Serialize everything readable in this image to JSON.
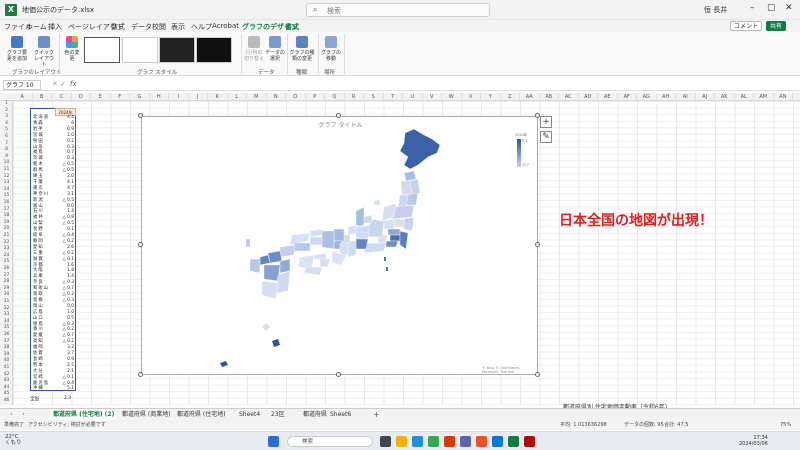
{
  "titlebar": {
    "filename": "地価公示のデータ.xlsx",
    "search_placeholder": "検索",
    "user": "恒 長井",
    "icon": "excel-icon"
  },
  "menu": {
    "items": [
      "ファイル",
      "ホーム",
      "挿入",
      "ページレイアウト",
      "数式",
      "データ",
      "校閲",
      "表示",
      "ヘルプ",
      "Acrobat",
      "グラフのデザイン",
      "書式"
    ],
    "active": "グラフのデザイン",
    "comment_btn": "コメント",
    "share_btn": "共有"
  },
  "ribbon": {
    "buttons": [
      {
        "label": "グラフ要素を追加",
        "icon": "add-chart-element-icon"
      },
      {
        "label": "クイックレイアウト",
        "icon": "quick-layout-icon"
      },
      {
        "label": "色の変更",
        "icon": "palette-icon"
      },
      {
        "label": "行/列の切り替え",
        "icon": "switch-row-col-icon"
      },
      {
        "label": "データの選択",
        "icon": "select-data-icon"
      },
      {
        "label": "グラフの種類の変更",
        "icon": "chart-type-icon"
      },
      {
        "label": "グラフの移動",
        "icon": "move-chart-icon"
      }
    ],
    "groups": [
      "グラフのレイアウト",
      "グラフ スタイル",
      "データ",
      "種類",
      "場所"
    ]
  },
  "formula_bar": {
    "namebox": "グラフ 10",
    "fx": "fx"
  },
  "columns": [
    "A",
    "B",
    "C",
    "D",
    "E",
    "F",
    "G",
    "H",
    "I",
    "J",
    "K",
    "L",
    "M",
    "N",
    "O",
    "P",
    "Q",
    "R",
    "S",
    "T",
    "U",
    "V",
    "W",
    "X",
    "Y",
    "Z",
    "AA",
    "AB",
    "AC",
    "AD",
    "AE",
    "AF",
    "AG",
    "AH",
    "AI",
    "AJ",
    "AK",
    "AL",
    "AM",
    "AN"
  ],
  "rows_count": 46,
  "table": {
    "header": "2024年",
    "rows": [
      {
        "pref": "北海道",
        "val": "4.4"
      },
      {
        "pref": "青森",
        "val": "6"
      },
      {
        "pref": "岩手",
        "val": "0.9"
      },
      {
        "pref": "宮城",
        "val": "1.0"
      },
      {
        "pref": "秋田",
        "val": "0.2"
      },
      {
        "pref": "山形",
        "val": "0.3"
      },
      {
        "pref": "福島",
        "val": "0.7"
      },
      {
        "pref": "茨城",
        "val": "0.3"
      },
      {
        "pref": "栃木",
        "val": "△ 0.5"
      },
      {
        "pref": "群馬",
        "val": "△ 0.5"
      },
      {
        "pref": "埼玉",
        "val": "2.0"
      },
      {
        "pref": "千葉",
        "val": "4.1"
      },
      {
        "pref": "東京",
        "val": "4.7"
      },
      {
        "pref": "神奈川",
        "val": "3.1"
      },
      {
        "pref": "新潟",
        "val": "△ 0.5"
      },
      {
        "pref": "富山",
        "val": "0.0"
      },
      {
        "pref": "石川",
        "val": "1.4"
      },
      {
        "pref": "福井",
        "val": "△ 0.8"
      },
      {
        "pref": "山梨",
        "val": "△ 0.5"
      },
      {
        "pref": "長野",
        "val": "0.1"
      },
      {
        "pref": "岐阜",
        "val": "△ 0.4"
      },
      {
        "pref": "静岡",
        "val": "△ 0.2"
      },
      {
        "pref": "愛知",
        "val": "2.6"
      },
      {
        "pref": "三重",
        "val": "△ 0.2"
      },
      {
        "pref": "滋賀",
        "val": "△ 0.1"
      },
      {
        "pref": "京都",
        "val": "1.6"
      },
      {
        "pref": "大阪",
        "val": "1.8"
      },
      {
        "pref": "兵庫",
        "val": "1.4"
      },
      {
        "pref": "奈良",
        "val": "△ 0.3"
      },
      {
        "pref": "和歌山",
        "val": "△ 0.7"
      },
      {
        "pref": "鳥取",
        "val": "△ 0.2"
      },
      {
        "pref": "島根",
        "val": "△ 0.3"
      },
      {
        "pref": "岡山",
        "val": "0.0"
      },
      {
        "pref": "広島",
        "val": "1.0"
      },
      {
        "pref": "山口",
        "val": "0.5"
      },
      {
        "pref": "徳島",
        "val": "△ 0.3"
      },
      {
        "pref": "香川",
        "val": "△ 0.2"
      },
      {
        "pref": "愛媛",
        "val": "△ 0.7"
      },
      {
        "pref": "高知",
        "val": "△ 0.2"
      },
      {
        "pref": "福岡",
        "val": "3.2"
      },
      {
        "pref": "佐賀",
        "val": "3.7"
      },
      {
        "pref": "長崎",
        "val": "0.9"
      },
      {
        "pref": "熊本",
        "val": "2.5"
      },
      {
        "pref": "大分",
        "val": "2.1"
      },
      {
        "pref": "宮崎",
        "val": "△ 0.1"
      },
      {
        "pref": "鹿児島",
        "val": "△ 0.4"
      },
      {
        "pref": "沖縄",
        "val": "5.1"
      }
    ],
    "total_label": "全国",
    "total_val": "2.3"
  },
  "chart": {
    "title": "グラフ タイトル",
    "legend_title": "2024年",
    "legend_high": "5.1",
    "legend_low": "-0.7",
    "copyright": "© Bing\n© GeoNames, Microsoft, TomTom",
    "side_buttons": [
      "+",
      "✎"
    ],
    "fill_color_high": "#2e5597",
    "fill_color_low": "#dbe4f3"
  },
  "annotation": "日本全国の地図が出現！",
  "below_subtitle": "都道府県別 住宅地価変動率（令和6年）",
  "sheets": [
    "都道府県 (住宅地) (2)",
    "都道府県 (商業地)",
    "都道府県 (住宅地)",
    "Sheet4",
    "23区",
    "都道府県",
    "Sheet6"
  ],
  "active_sheet": "都道府県 (住宅地) (2)",
  "status": {
    "ready": "準備完了",
    "accessibility": "アクセシビリティ: 検討が必要です",
    "average": "平均: 1.013636298",
    "count": "データの個数: 95",
    "sum": "合計: 47.5",
    "zoom": "75%"
  },
  "taskbar": {
    "weather_temp": "22°C",
    "weather_text": "くもり",
    "search": "検索",
    "time": "17:34",
    "date": "2024/03/06"
  }
}
